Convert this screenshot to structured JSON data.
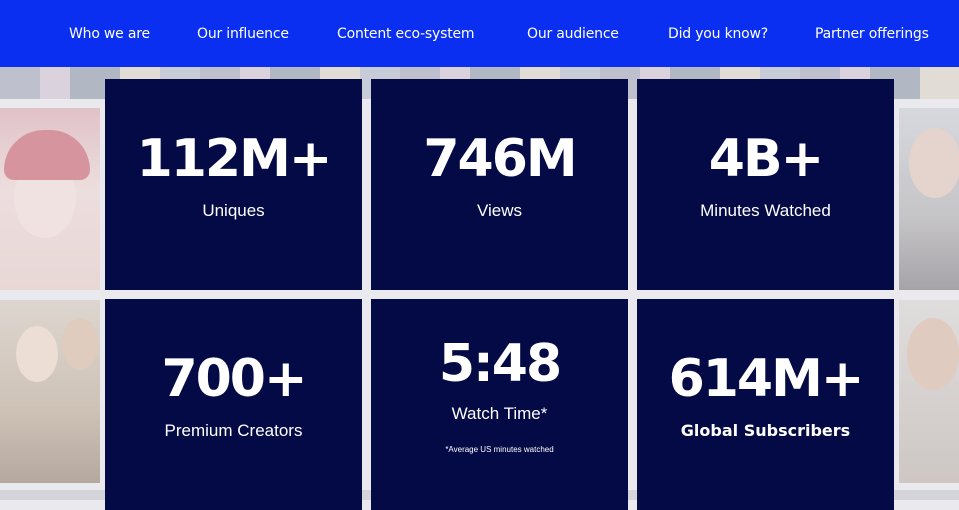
{
  "nav": {
    "items": [
      {
        "label": "Who we are"
      },
      {
        "label": "Our influence"
      },
      {
        "label": "Content eco-system"
      },
      {
        "label": "Our audience"
      },
      {
        "label": "Did you know?"
      },
      {
        "label": "Partner offerings"
      }
    ]
  },
  "stats": [
    {
      "value": "112M+",
      "label": "Uniques"
    },
    {
      "value": "746M",
      "label": "Views"
    },
    {
      "value": "4B+",
      "label": "Minutes Watched"
    },
    {
      "value": "700+",
      "label": "Premium Creators"
    },
    {
      "value": "5:48",
      "label": "Watch Time*",
      "note": "*Average US minutes watched"
    },
    {
      "value": "614M+",
      "label": "Global Subscribers"
    }
  ],
  "colors": {
    "nav_bg": "#0a2ff0",
    "card_bg": "#030a45",
    "text": "#ffffff"
  }
}
